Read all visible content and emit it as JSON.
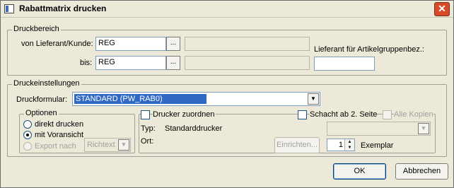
{
  "window": {
    "title": "Rabattmatrix drucken",
    "close_glyph": "✕"
  },
  "druckbereich": {
    "label": "Druckbereich",
    "von_label": "von Lieferant/Kunde:",
    "von_value": "REG",
    "bis_label": "bis:",
    "bis_value": "REG",
    "dots": "...",
    "lieferant_label": "Lieferant für Artikelgruppenbez.:",
    "lieferant_value": ""
  },
  "druckeinstellungen": {
    "label": "Druckeinstellungen",
    "formular_label": "Druckformular:",
    "formular_value": "STANDARD (PW_RAB0)",
    "dropdown_glyph": "▼"
  },
  "optionen": {
    "label": "Optionen",
    "direkt": "direkt drucken",
    "voransicht": "mit Voransicht",
    "export": "Export nach",
    "export_format": "Richtext",
    "selected": "mit Voransicht"
  },
  "drucker": {
    "zuordnen_label": "Drucker zuordnen",
    "schacht_label": "Schacht ab 2. Seite",
    "alle_kopien_label": "Alle Kopien",
    "typ_label": "Typ:",
    "typ_value": "Standarddrucker",
    "ort_label": "Ort:",
    "einrichten": "Einrichten...",
    "copies": "1",
    "exemplar_label": "Exemplar"
  },
  "buttons": {
    "ok": "OK",
    "abbrechen": "Abbrechen"
  }
}
